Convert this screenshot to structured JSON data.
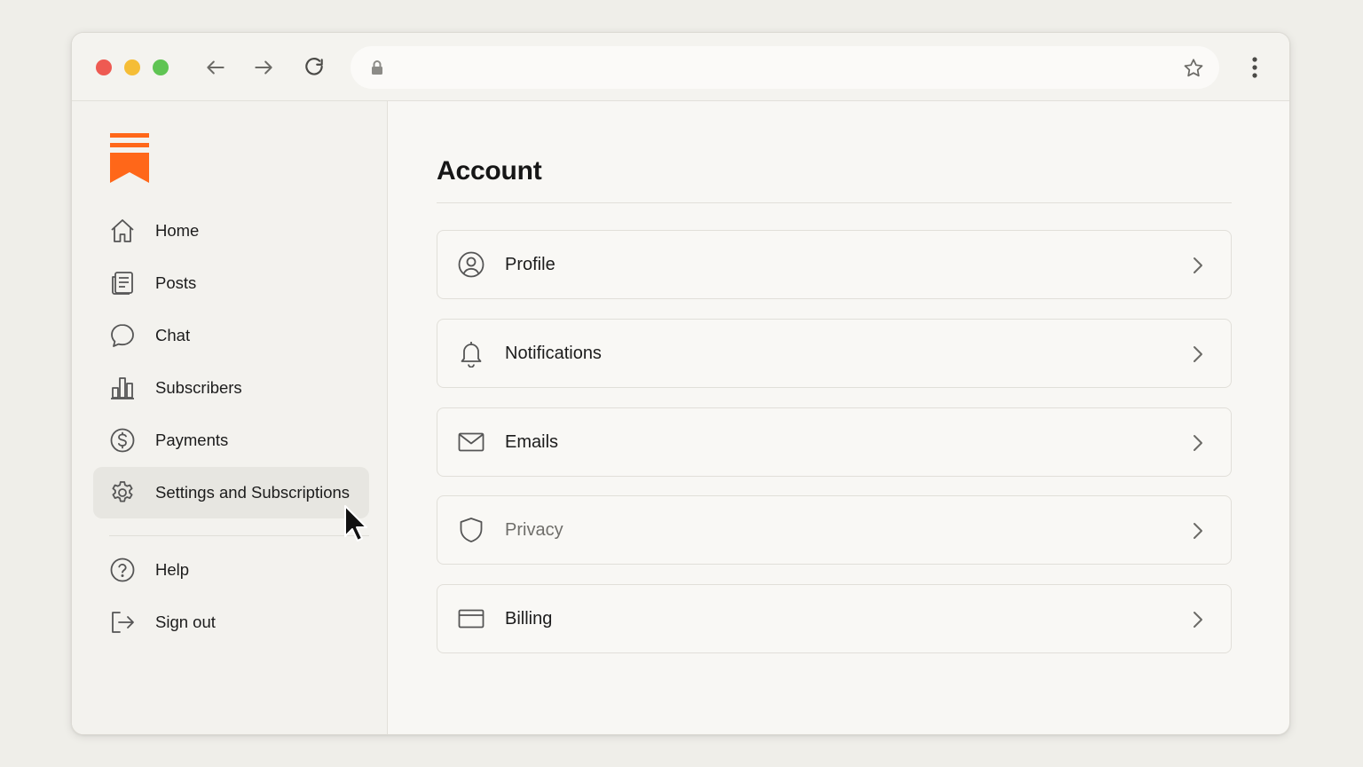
{
  "browser": {
    "address": "",
    "icons": [
      "back-arrow-icon",
      "forward-arrow-icon",
      "reload-icon",
      "lock-icon",
      "star-icon",
      "more-vertical-icon"
    ]
  },
  "sidebar": {
    "items": [
      {
        "label": "Home",
        "icon": "home-icon"
      },
      {
        "label": "Posts",
        "icon": "posts-icon"
      },
      {
        "label": "Chat",
        "icon": "chat-icon"
      },
      {
        "label": "Subscribers",
        "icon": "bar-chart-icon"
      },
      {
        "label": "Payments",
        "icon": "dollar-icon"
      },
      {
        "label": "Settings and Subscriptions",
        "icon": "gear-icon",
        "active": true
      }
    ],
    "footer_items": [
      {
        "label": "Help",
        "icon": "help-icon"
      },
      {
        "label": "Sign out",
        "icon": "sign-out-icon"
      }
    ]
  },
  "main": {
    "title": "Account",
    "rows": [
      {
        "label": "Profile",
        "icon": "user-circle-icon"
      },
      {
        "label": "Notifications",
        "icon": "bell-icon"
      },
      {
        "label": "Emails",
        "icon": "mail-icon"
      },
      {
        "label": "Privacy",
        "icon": "shield-icon"
      },
      {
        "label": "Billing",
        "icon": "credit-card-icon"
      }
    ]
  },
  "colors": {
    "brand": "#ff6719",
    "active_bg": "#e7e6e1"
  }
}
